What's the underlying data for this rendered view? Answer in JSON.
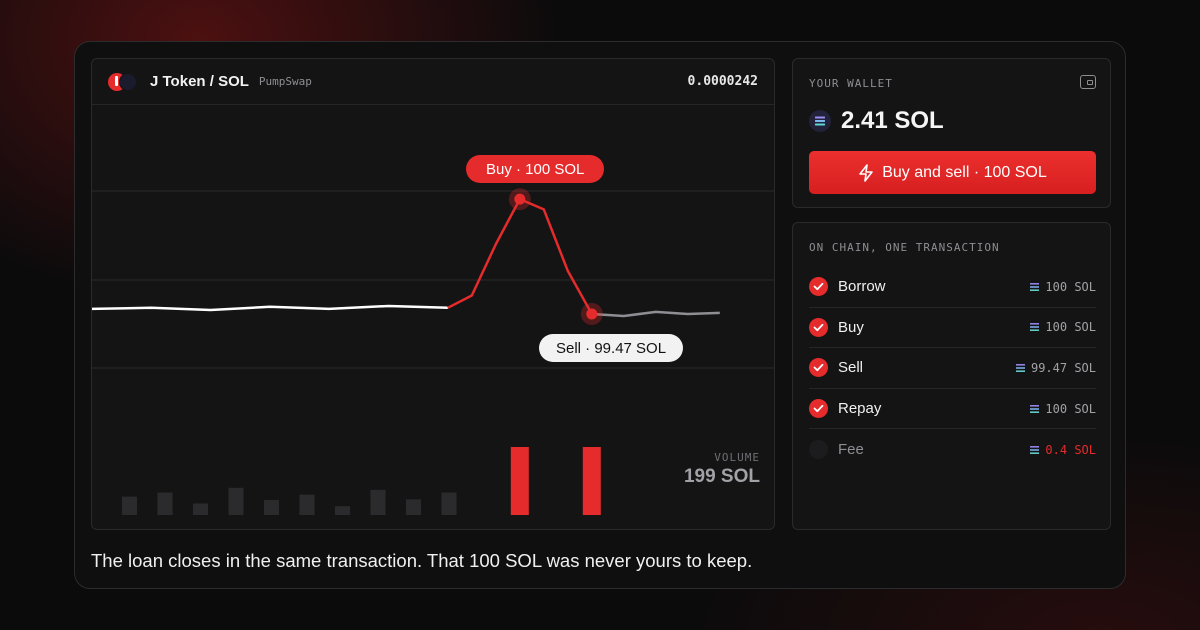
{
  "chart": {
    "pair_title": "J Token / SOL",
    "dex": "PumpSwap",
    "price": "0.0000242",
    "buy_tag": "Buy · 100 SOL",
    "sell_tag": "Sell · 99.47 SOL",
    "volume_label": "VOLUME",
    "volume_value": "199 SOL"
  },
  "wallet": {
    "heading": "YOUR WALLET",
    "balance": "2.41 SOL",
    "cta_label": "Buy and sell · 100 SOL"
  },
  "chain": {
    "heading": "ON CHAIN, ONE TRANSACTION",
    "steps": [
      {
        "label": "Borrow",
        "amount": "100 SOL"
      },
      {
        "label": "Buy",
        "amount": "100 SOL"
      },
      {
        "label": "Sell",
        "amount": "99.47 SOL"
      },
      {
        "label": "Repay",
        "amount": "100 SOL"
      },
      {
        "label": "Fee",
        "amount": "0.4 SOL"
      }
    ]
  },
  "caption": "The loan closes in the same transaction. That 100 SOL was never yours to keep.",
  "colors": {
    "accent": "#e52b2b",
    "line_normal": "#ffffff",
    "line_after": "#8e8e93",
    "panel": "#141415",
    "background": "#0b0b0c"
  },
  "icons": [
    "solana-icon",
    "wallet-icon",
    "lightning-icon",
    "check-icon"
  ],
  "price_series": {
    "before": [
      0.35,
      0.4,
      0.29,
      0.45,
      0.35,
      0.49,
      0.4
    ],
    "pump": [
      0.4,
      1.0,
      3.5,
      5.7,
      5.2,
      2.2,
      0.1
    ],
    "after": [
      0.1,
      0.0,
      0.2,
      0.1,
      0.15
    ]
  },
  "volume_series": {
    "normal": [
      0.27,
      0.33,
      0.17,
      0.4,
      0.22,
      0.3,
      0.13,
      0.37,
      0.23,
      0.33
    ],
    "buy": 1.0,
    "sell": 1.0
  }
}
